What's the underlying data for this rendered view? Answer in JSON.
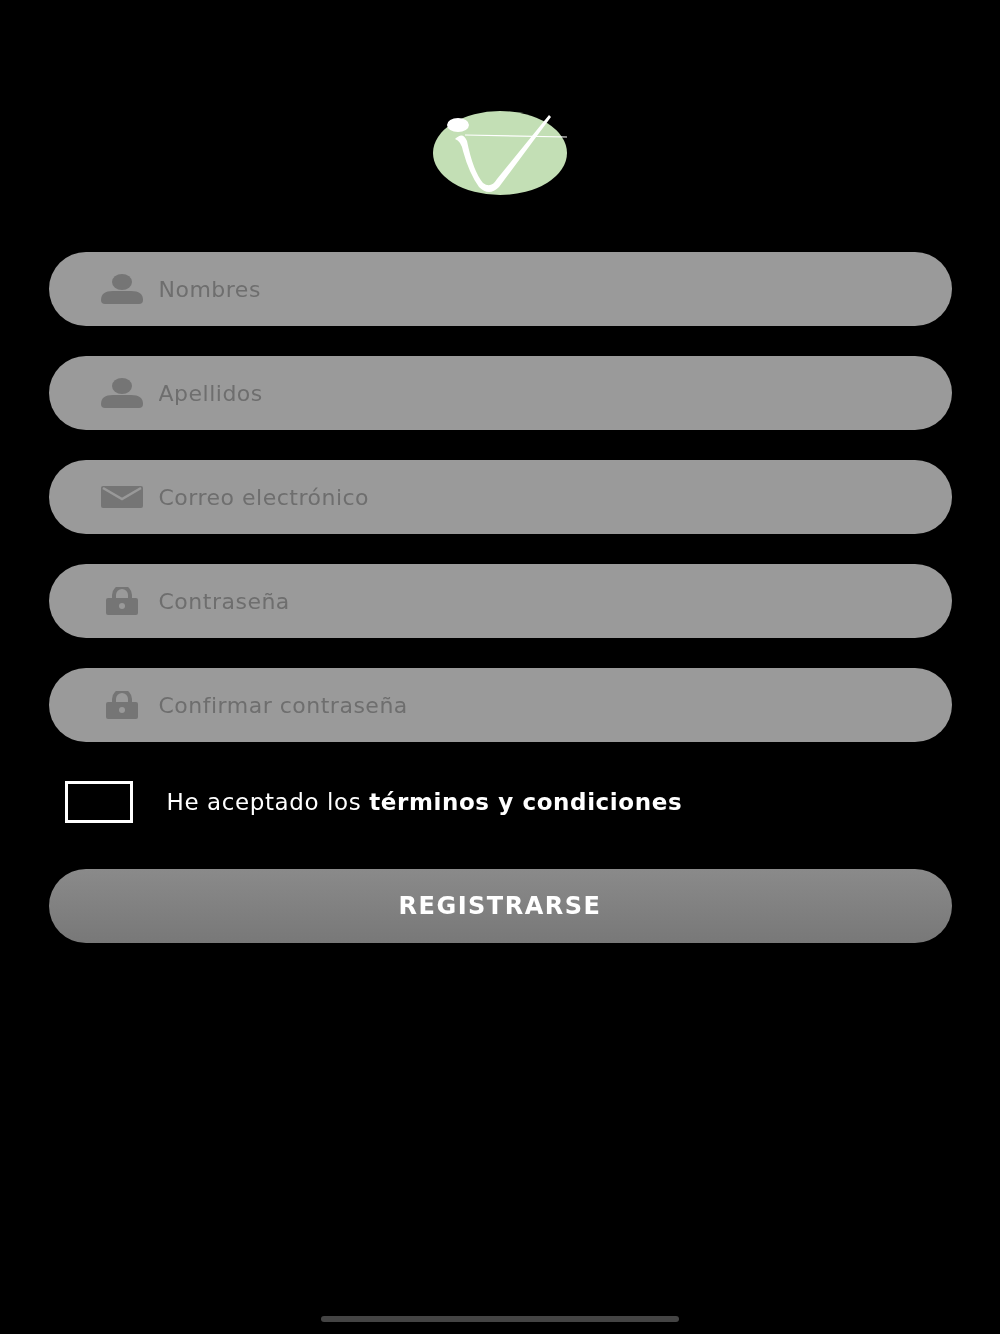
{
  "fields": [
    {
      "kind": "person",
      "placeholder": "Nombres"
    },
    {
      "kind": "person",
      "placeholder": "Apellidos"
    },
    {
      "kind": "email",
      "placeholder": "Correo electrónico"
    },
    {
      "kind": "password",
      "placeholder": "Contraseña"
    },
    {
      "kind": "password",
      "placeholder": "Confirmar contraseña"
    }
  ],
  "terms": {
    "checked": false,
    "text": "He aceptado los **términos y condiciones**"
  },
  "submit_button": "REGISTRARSE"
}
